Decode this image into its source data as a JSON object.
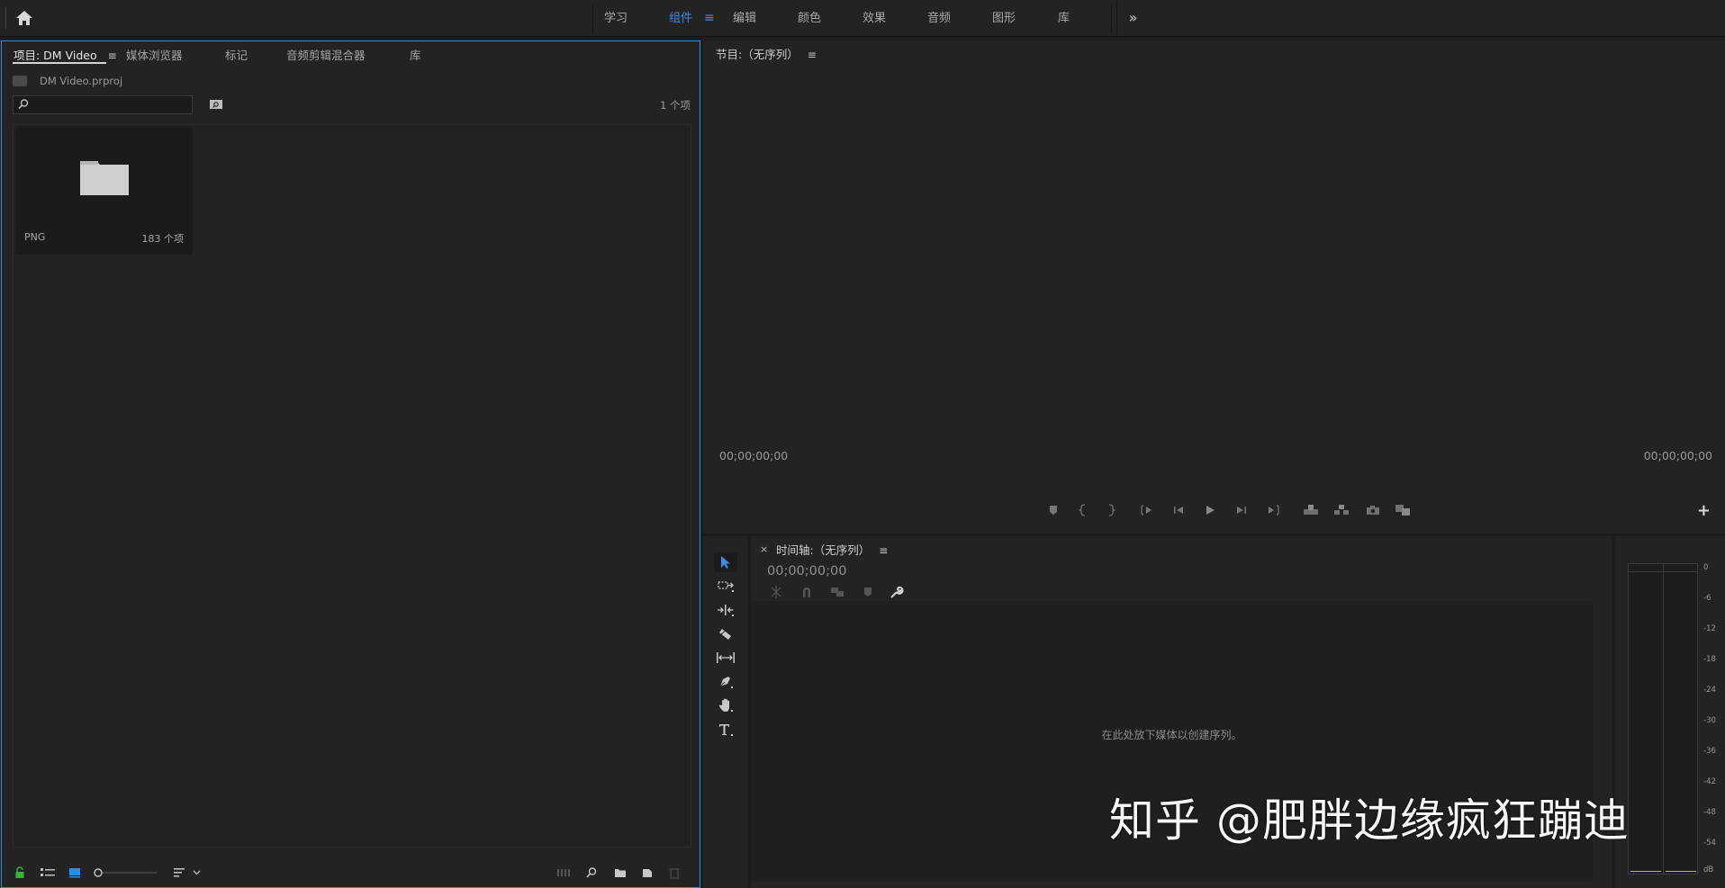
{
  "workspace_bar": {
    "tabs": [
      "学习",
      "组件",
      "编辑",
      "颜色",
      "效果",
      "音频",
      "图形",
      "库"
    ],
    "active_tab": "组件",
    "more_label": "»"
  },
  "project_panel": {
    "tabs": [
      "项目: DM Video",
      "媒体浏览器",
      "标记",
      "音频剪辑混合器",
      "库"
    ],
    "project_file": "DM Video.prproj",
    "search_placeholder": "",
    "item_count": "1 个项",
    "bins": [
      {
        "name": "PNG",
        "count": "183 个项"
      }
    ]
  },
  "program_monitor": {
    "title": "节目:（无序列）",
    "timecode_left": "00;00;00;00",
    "timecode_right": "00;00;00;00",
    "add_button": "+"
  },
  "timeline": {
    "close_label": "×",
    "title": "时间轴:（无序列）",
    "timecode": "00;00;00;00",
    "empty_hint": "在此处放下媒体以创建序列。"
  },
  "audio_meter": {
    "scale": [
      "0",
      "-6",
      "-12",
      "-18",
      "-24",
      "-30",
      "-36",
      "-42",
      "-48",
      "-54",
      "dB"
    ]
  },
  "watermark": "知乎 @肥胖边缘疯狂蹦迪",
  "colors": {
    "accent": "#2d8ceb",
    "panel_bg": "#232323",
    "app_bg": "#1d1d1d",
    "lock_green": "#35b535"
  },
  "menu_glyph": "≡"
}
